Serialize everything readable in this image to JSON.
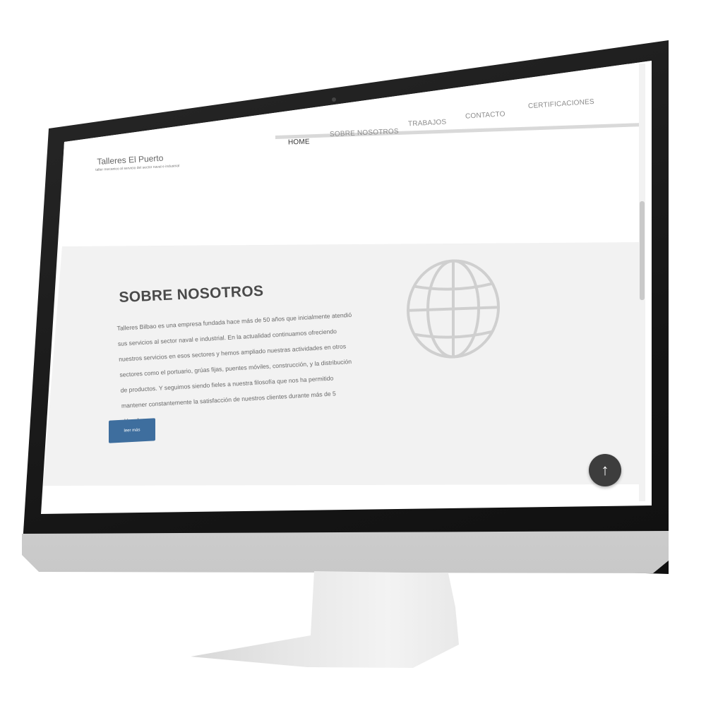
{
  "site": {
    "title": "Talleres El Puerto",
    "tagline": "taller mecanico al servicio del sector naval e industrial"
  },
  "nav": {
    "items": [
      {
        "label": "HOME",
        "active": true
      },
      {
        "label": "SOBRE NOSOTROS",
        "active": false
      },
      {
        "label": "TRABAJOS",
        "active": false
      },
      {
        "label": "CONTACTO",
        "active": false
      },
      {
        "label": "CERTIFICACIONES",
        "active": false
      }
    ]
  },
  "about": {
    "heading": "SOBRE NOSOTROS",
    "body": "Talleres Bilbao es una empresa fundada hace más de 50 años que inicialmente atendió sus servicios al sector naval e industrial. En la actualidad continuamos ofreciendo nuestros servicios en esos sectores y hemos ampliado nuestras actividades en otros sectores como el portuario, grúas fijas, puentes móviles, construcción, y la distribución de productos. Y seguimos siendo fieles a nuestra filosofía que nos ha permitido mantener constantemente la satisfacción de nuestros clientes durante más de 5 décadas.",
    "button_label": "leer más"
  },
  "icons": {
    "globe": "globe-icon",
    "back_to_top": "arrow-up-icon"
  },
  "colors": {
    "accent": "#3e6e9e",
    "band": "#f2f2f2",
    "fab": "#3d3d3d"
  }
}
